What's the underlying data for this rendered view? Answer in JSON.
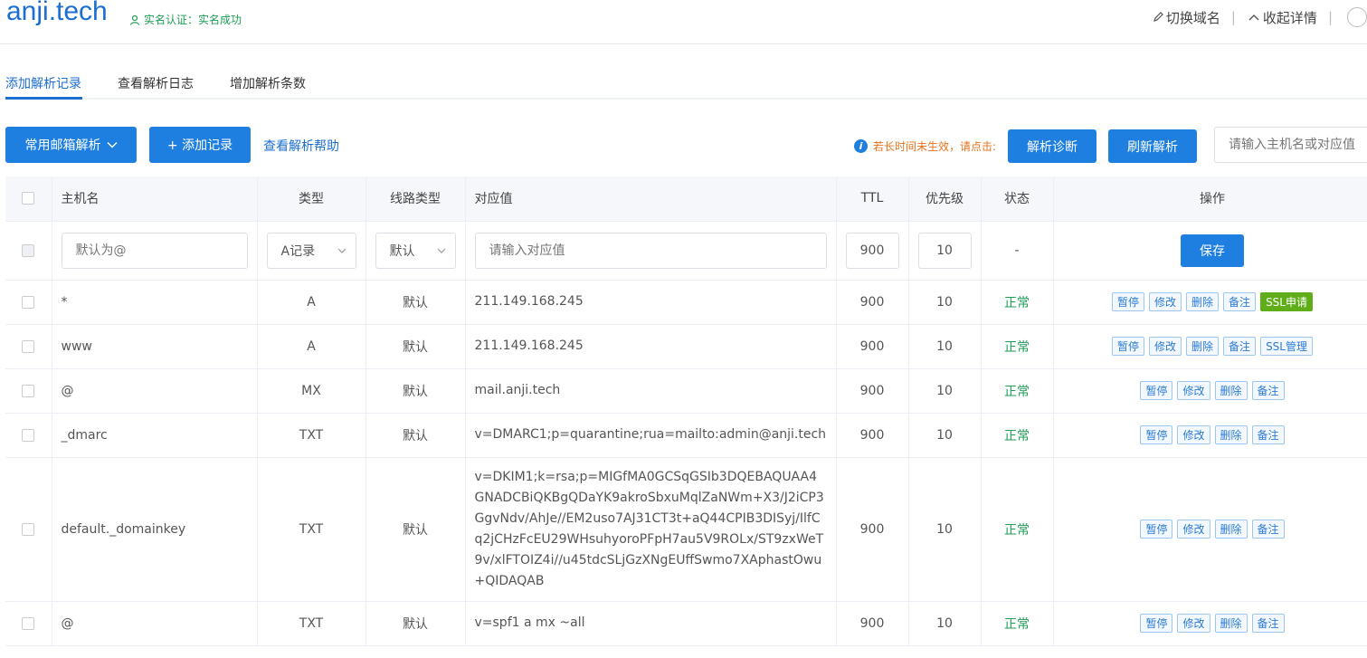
{
  "header": {
    "domain": "anji.tech",
    "verify_text": "实名认证：实名成功",
    "switch_domain": "切换域名",
    "collapse_details": "收起详情"
  },
  "tabs": [
    "添加解析记录",
    "查看解析日志",
    "增加解析条数"
  ],
  "toolbar": {
    "mail_btn": "常用邮箱解析",
    "add_btn": "+ 添加记录",
    "help_link": "查看解析帮助",
    "hint": "若长时间未生效，请点击:",
    "diagnose_btn": "解析诊断",
    "refresh_btn": "刷新解析",
    "search_placeholder": "请输入主机名或对应值"
  },
  "table": {
    "columns": [
      "主机名",
      "类型",
      "线路类型",
      "对应值",
      "TTL",
      "优先级",
      "状态",
      "操作"
    ],
    "new_row": {
      "host_placeholder": "默认为@",
      "type_value": "A记录",
      "line_value": "默认",
      "value_placeholder": "请输入对应值",
      "ttl": "900",
      "priority": "10",
      "status": "-",
      "save_label": "保存"
    },
    "rows": [
      {
        "host": "*",
        "type": "A",
        "line": "默认",
        "value": "211.149.168.245",
        "ttl": "900",
        "priority": "10",
        "status": "正常",
        "ops": [
          "暂停",
          "修改",
          "删除",
          "备注",
          "SSL申请"
        ]
      },
      {
        "host": "www",
        "type": "A",
        "line": "默认",
        "value": "211.149.168.245",
        "ttl": "900",
        "priority": "10",
        "status": "正常",
        "ops": [
          "暂停",
          "修改",
          "删除",
          "备注",
          "SSL管理"
        ]
      },
      {
        "host": "@",
        "type": "MX",
        "line": "默认",
        "value": "mail.anji.tech",
        "ttl": "900",
        "priority": "10",
        "status": "正常",
        "ops": [
          "暂停",
          "修改",
          "删除",
          "备注"
        ]
      },
      {
        "host": "_dmarc",
        "type": "TXT",
        "line": "默认",
        "value": "v=DMARC1;p=quarantine;rua=mailto:admin@anji.tech",
        "ttl": "900",
        "priority": "10",
        "status": "正常",
        "ops": [
          "暂停",
          "修改",
          "删除",
          "备注"
        ]
      },
      {
        "host": "default._domainkey",
        "type": "TXT",
        "line": "默认",
        "value": "v=DKIM1;k=rsa;p=MIGfMA0GCSqGSIb3DQEBAQUAA4GNADCBiQKBgQDaYK9akroSbxuMqlZaNWm+X3/J2iCP3GgvNdv/AhJe//EM2uso7AJ31CT3t+aQ44CPIB3DISyj/IlfCq2jCHzFcEU29WHsuhyoroPFpH7au5V9ROLx/ST9zxWeT9v/xlFTOIZ4i//u45tdcSLjGzXNgEUffSwmo7XAphastOwu+QIDAQAB",
        "ttl": "900",
        "priority": "10",
        "status": "正常",
        "ops": [
          "暂停",
          "修改",
          "删除",
          "备注"
        ]
      },
      {
        "host": "@",
        "type": "TXT",
        "line": "默认",
        "value": "v=spf1 a mx ~all",
        "ttl": "900",
        "priority": "10",
        "status": "正常",
        "ops": [
          "暂停",
          "修改",
          "删除",
          "备注"
        ]
      }
    ]
  },
  "colors": {
    "accent": "#1e7fe0",
    "success": "#1f9d55",
    "warning": "#e6731c",
    "ssl_green": "#5fad19"
  }
}
